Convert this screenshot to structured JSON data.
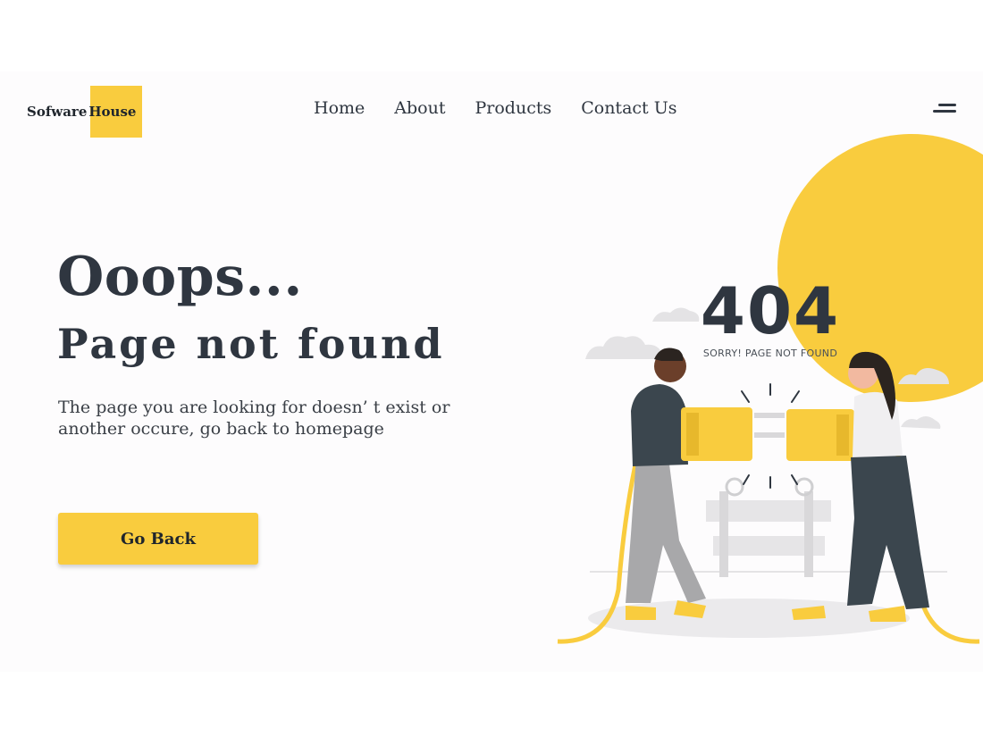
{
  "header": {
    "logo_text": "Sofware",
    "logo_highlight": "House",
    "nav": [
      {
        "label": "Home"
      },
      {
        "label": "About"
      },
      {
        "label": "Products"
      },
      {
        "label": "Contact Us"
      }
    ],
    "menu_icon": "hamburger-menu-icon"
  },
  "hero": {
    "heading": "Ooops...",
    "subheading": "Page not found",
    "description": "The page you are looking for doesn’ t exist or another occure, go back to homepage",
    "button_label": "Go Back"
  },
  "illustration": {
    "code": "404",
    "caption": "SORRY! PAGE NOT FOUND"
  },
  "colors": {
    "accent": "#f9cc3e",
    "text": "#2f3640",
    "background": "#fdfcfd"
  }
}
